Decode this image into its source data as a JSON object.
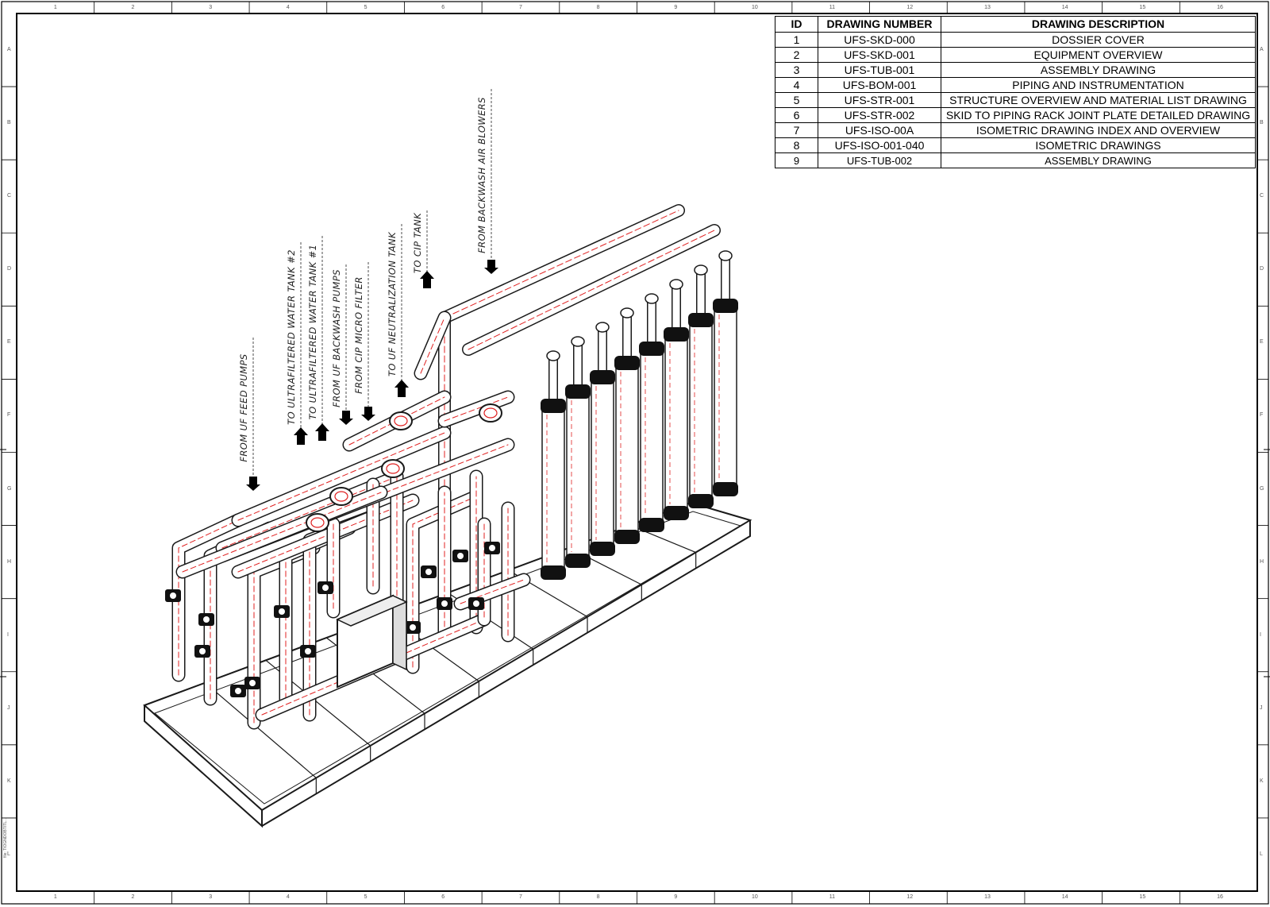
{
  "sheet": {
    "zones_x": [
      "1",
      "2",
      "3",
      "4",
      "5",
      "6",
      "7",
      "8",
      "9",
      "10",
      "11",
      "12",
      "13",
      "14",
      "15",
      "16"
    ],
    "zones_y": [
      "A",
      "B",
      "C",
      "D",
      "E",
      "F",
      "G",
      "H",
      "I",
      "J",
      "K",
      "L"
    ],
    "side_mark": "file: TIOGNDOBTITL..."
  },
  "drawing_index": {
    "headers": [
      "ID",
      "DRAWING NUMBER",
      "DRAWING DESCRIPTION"
    ],
    "rows": [
      [
        "1",
        "UFS-SKD-000",
        "DOSSIER COVER"
      ],
      [
        "2",
        "UFS-SKD-001",
        "EQUIPMENT OVERVIEW"
      ],
      [
        "3",
        "UFS-TUB-001",
        "ASSEMBLY DRAWING"
      ],
      [
        "4",
        "UFS-BOM-001",
        "PIPING AND INSTRUMENTATION"
      ],
      [
        "5",
        "UFS-STR-001",
        "STRUCTURE OVERVIEW AND MATERIAL LIST DRAWING"
      ],
      [
        "6",
        "UFS-STR-002",
        "SKID TO PIPING RACK JOINT PLATE DETAILED DRAWING"
      ],
      [
        "7",
        "UFS-ISO-00A",
        "ISOMETRIC DRAWING INDEX  AND OVERVIEW"
      ],
      [
        "8",
        "UFS-ISO-001-040",
        "ISOMETRIC DRAWINGS"
      ],
      [
        "9",
        "UFS-TUB-002",
        "ASSEMBLY DRAWING"
      ]
    ]
  },
  "callouts": [
    {
      "text": "FROM UF FEED PUMPS",
      "direction": "in"
    },
    {
      "text": "TO ULTRAFILTERED WATER TANK #2",
      "direction": "out"
    },
    {
      "text": "TO ULTRAFILTERED WATER TANK #1",
      "direction": "out"
    },
    {
      "text": "FROM UF BACKWASH PUMPS",
      "direction": "in"
    },
    {
      "text": "FROM CIP MICRO FILTER",
      "direction": "in"
    },
    {
      "text": "TO UF NEUTRALIZATION TANK",
      "direction": "out"
    },
    {
      "text": "TO CIP TANK",
      "direction": "out"
    },
    {
      "text": "FROM BACKWASH AIR BLOWERS",
      "direction": "in"
    }
  ],
  "colors": {
    "line": "#1a1a1a",
    "pipe_centerline": "#e02020",
    "membrane": "#ffffff",
    "cap": "#111111"
  }
}
